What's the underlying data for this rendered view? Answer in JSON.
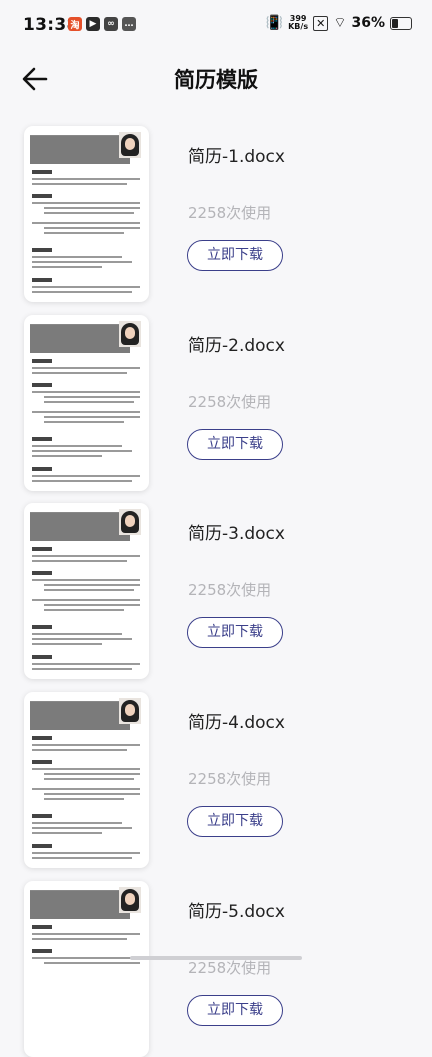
{
  "status": {
    "time": "13:38",
    "net_speed_value": "399",
    "net_speed_unit": "KB/s",
    "battery": "36%"
  },
  "header": {
    "title": "简历模版"
  },
  "templates": [
    {
      "name": "简历-1.docx",
      "usage": "2258次使用",
      "action": "立即下载"
    },
    {
      "name": "简历-2.docx",
      "usage": "2258次使用",
      "action": "立即下载"
    },
    {
      "name": "简历-3.docx",
      "usage": "2258次使用",
      "action": "立即下载"
    },
    {
      "name": "简历-4.docx",
      "usage": "2258次使用",
      "action": "立即下载"
    },
    {
      "name": "简历-5.docx",
      "usage": "2258次使用",
      "action": "立即下载"
    }
  ]
}
